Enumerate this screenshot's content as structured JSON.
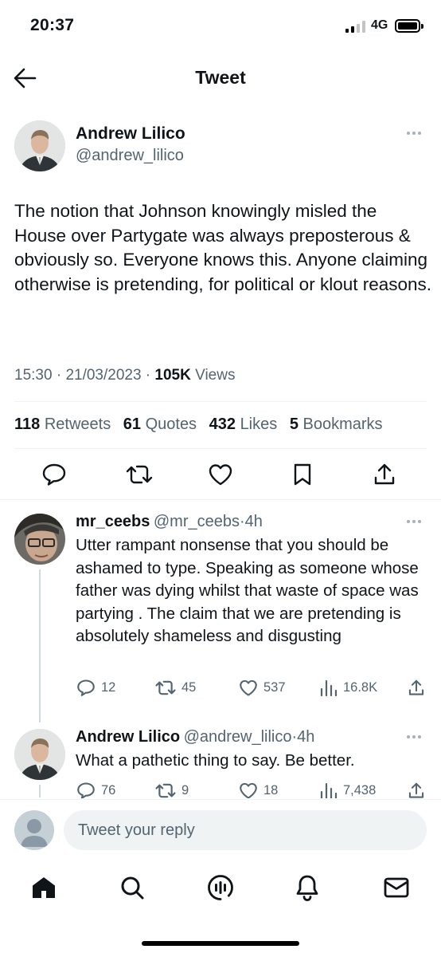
{
  "status_bar": {
    "time": "20:37",
    "network": "4G",
    "signal_bars": 4,
    "signal_active": 2,
    "battery_level": 1.0
  },
  "header": {
    "title": "Tweet",
    "back_icon": "arrow-left-icon"
  },
  "tweet": {
    "author_name": "Andrew Lilico",
    "author_handle": "@andrew_lilico",
    "text": "The notion that Johnson knowingly misled the House over Partygate was always preposterous & obviously so. Everyone knows this. Anyone claiming otherwise is pretending, for political or klout reasons.",
    "time": "15:30",
    "date": "21/03/2023",
    "views_count": "105K",
    "views_label": "Views",
    "retweets_count": "118",
    "retweets_label": "Retweets",
    "quotes_count": "61",
    "quotes_label": "Quotes",
    "likes_count": "432",
    "likes_label": "Likes",
    "bookmarks_count": "5",
    "bookmarks_label": "Bookmarks"
  },
  "replies": [
    {
      "name": "mr_ceebs",
      "handle": "@mr_ceebs",
      "age": "4h",
      "text": "Utter rampant nonsense  that you should be ashamed to type. Speaking as someone whose father was dying whilst that waste of space was partying . The claim that we are pretending is absolutely shameless and disgusting",
      "replies": "12",
      "retweets": "45",
      "likes": "537",
      "views": "16.8K"
    },
    {
      "name": "Andrew Lilico",
      "handle": "@andrew_lilico",
      "age": "4h",
      "text": "What a pathetic thing to say. Be better.",
      "replies": "76",
      "retweets": "9",
      "likes": "18",
      "views": "7,438"
    }
  ],
  "reply_bar": {
    "placeholder": "Tweet your reply"
  },
  "bottom_nav": [
    "home-icon",
    "search-icon",
    "spaces-icon",
    "notifications-icon",
    "messages-icon"
  ],
  "colors": {
    "text": "#0f1419",
    "secondary": "#536471",
    "divider": "#eff3f4"
  }
}
